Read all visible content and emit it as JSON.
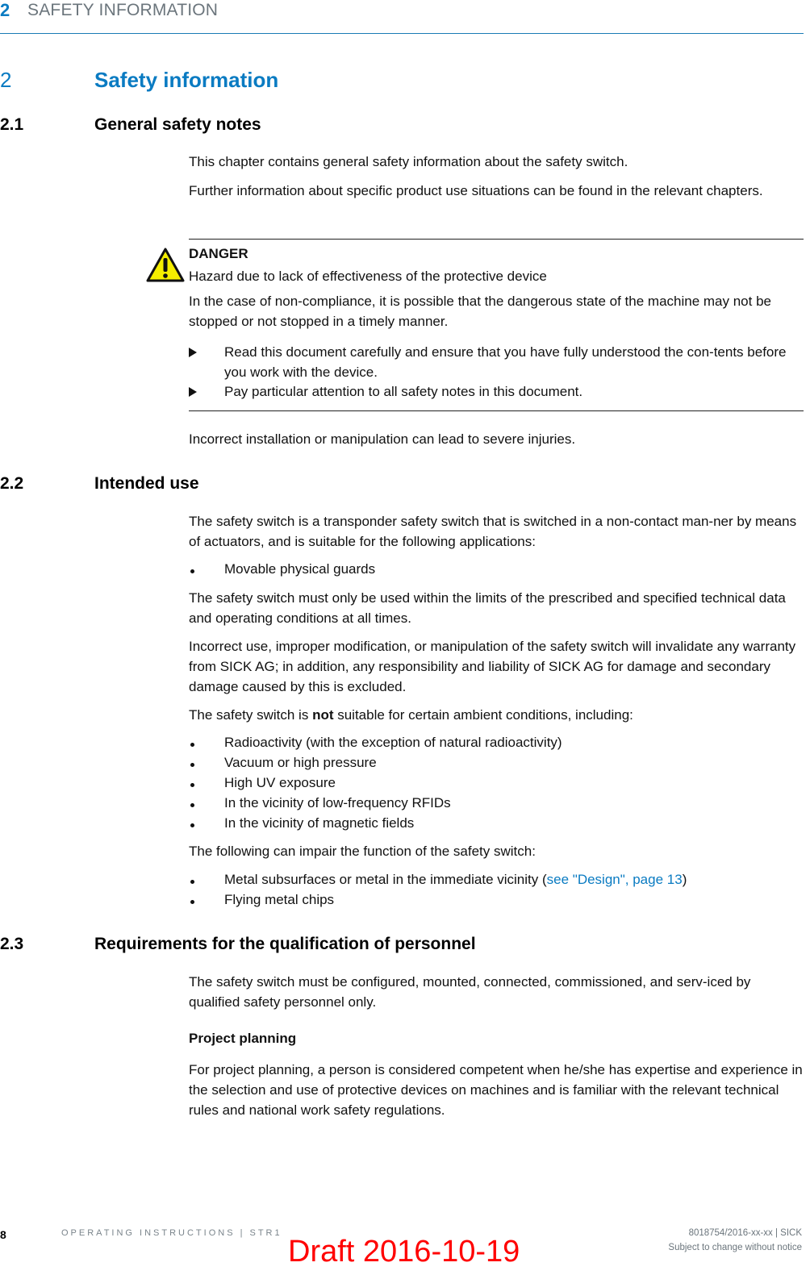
{
  "header": {
    "chapter_number": "2",
    "chapter_title": "SAFETY INFORMATION"
  },
  "chapter": {
    "number": "2",
    "title": "Safety information"
  },
  "section_2_1": {
    "number": "2.1",
    "title": "General safety notes",
    "para1": "This chapter contains general safety information about the safety switch.",
    "para2": "Further information about specific product use situations can be found in the relevant chapters.",
    "danger": {
      "icon": "warning-triangle-icon",
      "label": "DANGER",
      "heading": "Hazard due to lack of effectiveness of the protective device",
      "text": "In the case of non-compliance, it is possible that the dangerous state of the machine may not be stopped or not stopped in a timely manner.",
      "actions": [
        "Read this document carefully and ensure that you have fully understood the con-tents before you work with the device.",
        "Pay particular attention to all safety notes in this document."
      ]
    },
    "para3": "Incorrect installation or manipulation can lead to severe injuries."
  },
  "section_2_2": {
    "number": "2.2",
    "title": "Intended use",
    "para1": "The safety switch is a transponder safety switch that is switched in a non-contact man-ner by means of actuators, and is suitable for the following applications:",
    "applications": [
      "Movable physical guards"
    ],
    "para2": "The safety switch must only be used within the limits of the prescribed and specified technical data and operating conditions at all times.",
    "para3": "Incorrect use, improper modification, or manipulation of the safety switch will invalidate any warranty from SICK AG; in addition, any responsibility and liability of SICK AG for damage and secondary damage caused by this is excluded.",
    "para4_pre": "The safety switch is ",
    "para4_bold": "not",
    "para4_post": " suitable for certain ambient conditions, including:",
    "conditions": [
      "Radioactivity (with the exception of natural radioactivity)",
      "Vacuum or high pressure",
      "High UV exposure",
      "In the vicinity of low-frequency RFIDs",
      "In the vicinity of magnetic fields"
    ],
    "para5": "The following can impair the function of the safety switch:",
    "impair_1_pre": "Metal subsurfaces or metal in the immediate vicinity (",
    "impair_1_link": "see \"Design\", page 13",
    "impair_1_post": ")",
    "impair_2": "Flying metal chips"
  },
  "section_2_3": {
    "number": "2.3",
    "title": "Requirements for the qualification of personnel",
    "para1": "The safety switch must be configured, mounted, connected, commissioned, and serv-iced by qualified safety personnel only.",
    "subheading": "Project planning",
    "para2": "For project planning, a person is considered competent when he/she has expertise and experience in the selection and use of protective devices on machines and is familiar with the relevant technical rules and national work safety regulations."
  },
  "footer": {
    "page_number": "8",
    "document": "OPERATING INSTRUCTIONS | STR1",
    "doc_id": "8018754/2016-xx-xx | SICK",
    "notice": "Subject to change without notice",
    "watermark": "Draft 2016-10-19"
  },
  "colors": {
    "accent": "#0a7bc2",
    "header_gray": "#6b757c",
    "warning_yellow": "#f5ee00",
    "draft_red": "#ff0000"
  }
}
